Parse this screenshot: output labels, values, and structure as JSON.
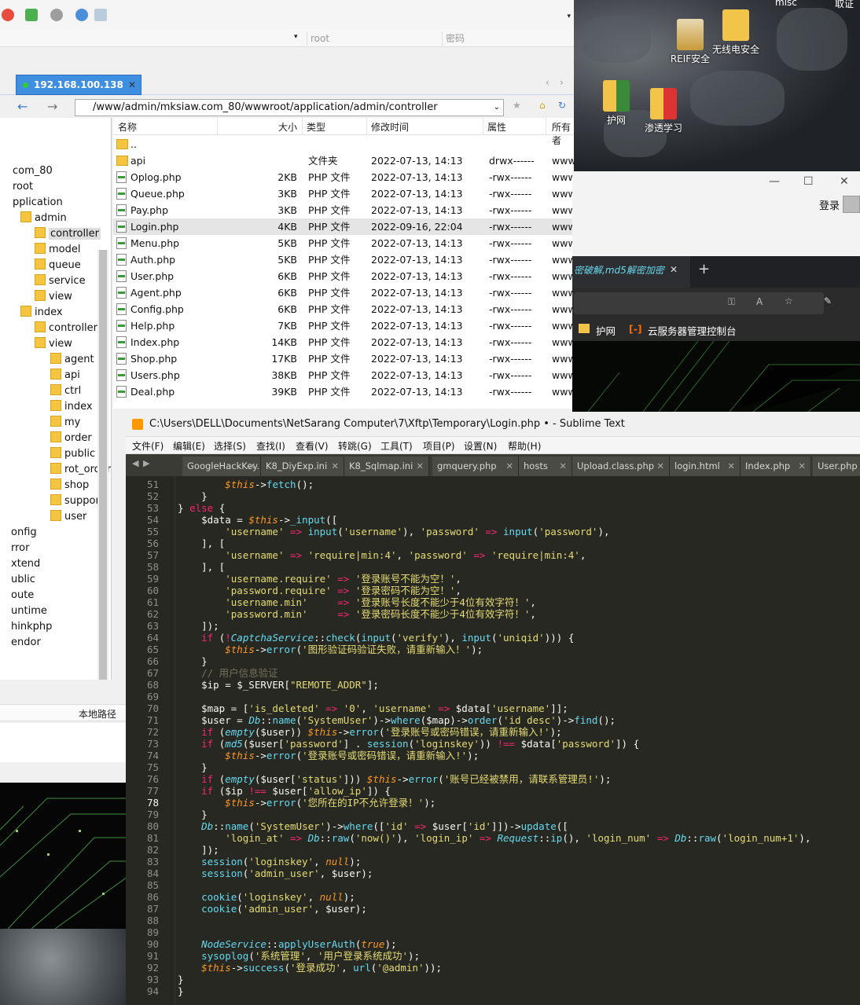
{
  "desktop": {
    "icons": [
      {
        "label": "REIF安全"
      },
      {
        "label": "无线电安全"
      },
      {
        "label": "护网"
      },
      {
        "label": "渗透学习"
      }
    ],
    "top_labels": [
      "misc",
      "取证"
    ]
  },
  "xftp": {
    "address": {
      "host_dropdown": "",
      "user": "root",
      "password_placeholder": "密码"
    },
    "session_tab": "192.168.100.138",
    "path": "/www/admin/mksiaw.com_80/wwwroot/application/admin/controller",
    "tree": [
      {
        "label": "com_80"
      },
      {
        "label": "root"
      },
      {
        "label": "pplication"
      },
      {
        "label": "admin"
      },
      {
        "label": "controller"
      },
      {
        "label": "model"
      },
      {
        "label": "queue"
      },
      {
        "label": "service"
      },
      {
        "label": "view"
      },
      {
        "label": "index"
      },
      {
        "label": "controller"
      },
      {
        "label": "view"
      },
      {
        "label": "agent"
      },
      {
        "label": "api"
      },
      {
        "label": "ctrl"
      },
      {
        "label": "index"
      },
      {
        "label": "my"
      },
      {
        "label": "order"
      },
      {
        "label": "public"
      },
      {
        "label": "rot_order"
      },
      {
        "label": "shop"
      },
      {
        "label": "support"
      },
      {
        "label": "user"
      },
      {
        "label": "onfig"
      },
      {
        "label": "rror"
      },
      {
        "label": "xtend"
      },
      {
        "label": "ublic"
      },
      {
        "label": "oute"
      },
      {
        "label": "untime"
      },
      {
        "label": "hinkphp"
      },
      {
        "label": "endor"
      }
    ],
    "columns": [
      "名称",
      "大小",
      "类型",
      "修改时间",
      "属性",
      "所有者"
    ],
    "files": [
      {
        "name": "..",
        "size": "",
        "type": "",
        "mtime": "",
        "attr": "",
        "owner": ""
      },
      {
        "name": "api",
        "size": "",
        "type": "文件夹",
        "mtime": "2022-07-13, 14:13",
        "attr": "drwx------",
        "owner": "www"
      },
      {
        "name": "Oplog.php",
        "size": "2KB",
        "type": "PHP 文件",
        "mtime": "2022-07-13, 14:13",
        "attr": "-rwx------",
        "owner": "www"
      },
      {
        "name": "Queue.php",
        "size": "3KB",
        "type": "PHP 文件",
        "mtime": "2022-07-13, 14:13",
        "attr": "-rwx------",
        "owner": "www"
      },
      {
        "name": "Pay.php",
        "size": "3KB",
        "type": "PHP 文件",
        "mtime": "2022-07-13, 14:13",
        "attr": "-rwx------",
        "owner": "www"
      },
      {
        "name": "Login.php",
        "size": "4KB",
        "type": "PHP 文件",
        "mtime": "2022-09-16, 22:04",
        "attr": "-rwx------",
        "owner": "www"
      },
      {
        "name": "Menu.php",
        "size": "5KB",
        "type": "PHP 文件",
        "mtime": "2022-07-13, 14:13",
        "attr": "-rwx------",
        "owner": "www"
      },
      {
        "name": "Auth.php",
        "size": "5KB",
        "type": "PHP 文件",
        "mtime": "2022-07-13, 14:13",
        "attr": "-rwx------",
        "owner": "www"
      },
      {
        "name": "User.php",
        "size": "6KB",
        "type": "PHP 文件",
        "mtime": "2022-07-13, 14:13",
        "attr": "-rwx------",
        "owner": "www"
      },
      {
        "name": "Agent.php",
        "size": "6KB",
        "type": "PHP 文件",
        "mtime": "2022-07-13, 14:13",
        "attr": "-rwx------",
        "owner": "www"
      },
      {
        "name": "Config.php",
        "size": "6KB",
        "type": "PHP 文件",
        "mtime": "2022-07-13, 14:13",
        "attr": "-rwx------",
        "owner": "www"
      },
      {
        "name": "Help.php",
        "size": "7KB",
        "type": "PHP 文件",
        "mtime": "2022-07-13, 14:13",
        "attr": "-rwx------",
        "owner": "www"
      },
      {
        "name": "Index.php",
        "size": "14KB",
        "type": "PHP 文件",
        "mtime": "2022-07-13, 14:13",
        "attr": "-rwx------",
        "owner": "www"
      },
      {
        "name": "Shop.php",
        "size": "17KB",
        "type": "PHP 文件",
        "mtime": "2022-07-13, 14:13",
        "attr": "-rwx------",
        "owner": "www"
      },
      {
        "name": "Users.php",
        "size": "38KB",
        "type": "PHP 文件",
        "mtime": "2022-07-13, 14:13",
        "attr": "-rwx------",
        "owner": "www"
      },
      {
        "name": "Deal.php",
        "size": "39KB",
        "type": "PHP 文件",
        "mtime": "2022-07-13, 14:13",
        "attr": "-rwx------",
        "owner": "www"
      }
    ],
    "local_path_header": "本地路径"
  },
  "browser": {
    "login": "登录",
    "tab_title": "密破解,md5解密加密",
    "bookmarks": [
      "护网",
      "云服务器管理控制台"
    ],
    "window_controls": [
      "—",
      "☐",
      "✕"
    ]
  },
  "sublime": {
    "title": "C:\\Users\\DELL\\Documents\\NetSarang Computer\\7\\Xftp\\Temporary\\Login.php • - Sublime Text",
    "menu": [
      "文件(F)",
      "编辑(E)",
      "选择(S)",
      "查找(I)",
      "查看(V)",
      "转跳(G)",
      "工具(T)",
      "项目(P)",
      "设置(N)",
      "帮助(H)"
    ],
    "tabs": [
      "GoogleHackKey.in",
      "K8_DiyExp.ini",
      "K8_Sqlmap.ini",
      "gmquery.php",
      "hosts",
      "Upload.class.php",
      "login.html",
      "Index.php",
      "User.php"
    ],
    "first_line": 51,
    "active_line": 78
  }
}
